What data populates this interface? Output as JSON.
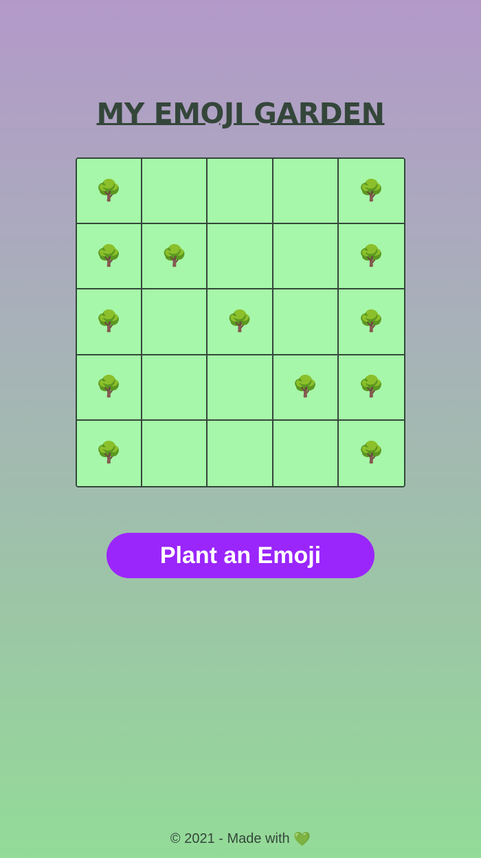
{
  "header": {
    "title": "MY EMOJI GARDEN"
  },
  "garden": {
    "rows": [
      [
        "🌳",
        "",
        "",
        "",
        "🌳"
      ],
      [
        "🌳",
        "🌳",
        "",
        "",
        "🌳"
      ],
      [
        "🌳",
        "",
        "🌳",
        "",
        "🌳"
      ],
      [
        "🌳",
        "",
        "",
        "🌳",
        "🌳"
      ],
      [
        "🌳",
        "",
        "",
        "",
        "🌳"
      ]
    ]
  },
  "actions": {
    "plant_label": "Plant an Emoji"
  },
  "footer": {
    "text": "© 2021 - Made with",
    "heart": "💚",
    "heart_icon": "green-heart-icon"
  },
  "colors": {
    "title": "#34463a",
    "plot": "#a6f7a9",
    "button": "#9a26fb",
    "gradient_top": "#b399c9",
    "gradient_bottom": "#93db98"
  }
}
